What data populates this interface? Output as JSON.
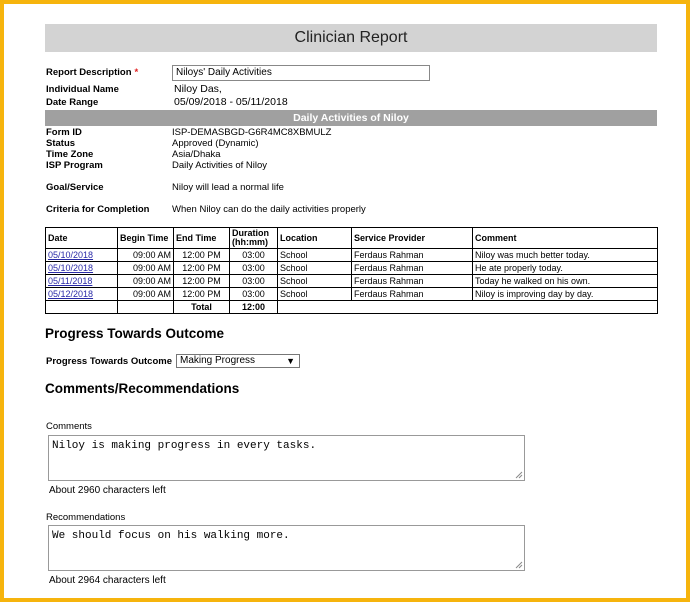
{
  "header": {
    "title": "Clinician Report"
  },
  "report": {
    "description_label": "Report Description",
    "required_mark": "*",
    "description_value": "Niloys' Daily Activities",
    "individual_label": "Individual Name",
    "individual_value": "Niloy  Das,",
    "date_range_label": "Date Range",
    "date_range_value": "05/09/2018 - 05/11/2018"
  },
  "section": {
    "title": "Daily Activities of Niloy"
  },
  "details": {
    "form_id_label": "Form ID",
    "form_id_value": "ISP-DEMASBGD-G6R4MC8XBMULZ",
    "status_label": "Status",
    "status_value": "Approved (Dynamic)",
    "timezone_label": "Time Zone",
    "timezone_value": "Asia/Dhaka",
    "program_label": "ISP Program",
    "program_value": "Daily Activities of Niloy",
    "goal_label": "Goal/Service",
    "goal_value": "Niloy will lead a normal life",
    "criteria_label": "Criteria for Completion",
    "criteria_value": "When Niloy can do the daily activities properly"
  },
  "table": {
    "headers": [
      "Date",
      "Begin Time",
      "End Time",
      "Duration (hh:mm)",
      "Location",
      "Service Provider",
      "Comment"
    ],
    "rows": [
      [
        "05/10/2018",
        "09:00 AM",
        "12:00 PM",
        "03:00",
        "School",
        "Ferdaus Rahman",
        "Niloy was much better today."
      ],
      [
        "05/10/2018",
        "09:00 AM",
        "12:00 PM",
        "03:00",
        "School",
        "Ferdaus Rahman",
        "He ate properly today."
      ],
      [
        "05/11/2018",
        "09:00 AM",
        "12:00 PM",
        "03:00",
        "School",
        "Ferdaus Rahman",
        "Today he walked on his own."
      ],
      [
        "05/12/2018",
        "09:00 AM",
        "12:00 PM",
        "03:00",
        "School",
        "Ferdaus Rahman",
        "Niloy is improving day by day."
      ]
    ],
    "total_label": "Total",
    "total_value": "12:00"
  },
  "progress": {
    "heading": "Progress Towards Outcome",
    "label": "Progress Towards Outcome",
    "selected": "Making Progress"
  },
  "comments": {
    "heading": "Comments/Recommendations",
    "comments_label": "Comments",
    "comments_value": "Niloy is making progress in every tasks.",
    "comments_left": "About 2960 characters left",
    "recommendations_label": "Recommendations",
    "recommendations_value": "We should focus on his walking more.",
    "recommendations_left": "About 2964 characters left"
  },
  "colors": {
    "frame_border": "#f6b40d",
    "title_bar": "#d3d3d3",
    "section_bar": "#a0a0a0",
    "link": "#2a2aa8"
  }
}
